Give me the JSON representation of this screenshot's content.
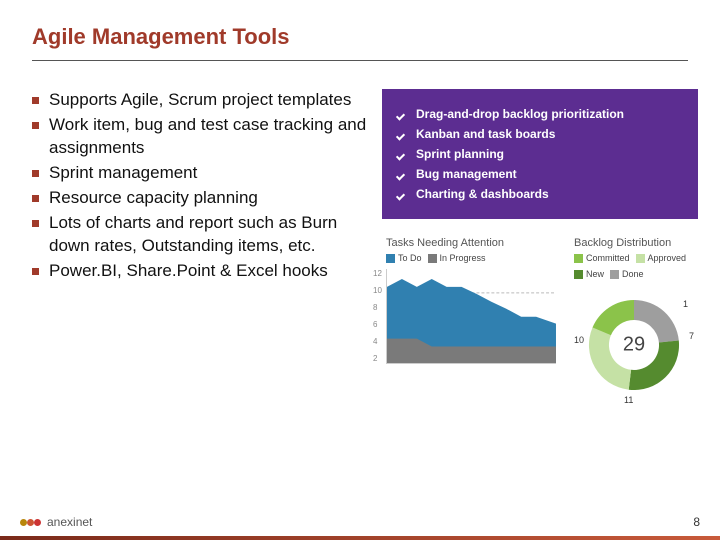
{
  "title": "Agile Management Tools",
  "bullets": [
    "Supports Agile, Scrum project templates",
    "Work item, bug and test case tracking and assignments",
    "Sprint management",
    "Resource capacity planning",
    "Lots of charts and report such as Burn down rates, Outstanding items, etc.",
    "Power.BI, Share.Point & Excel hooks"
  ],
  "purple_features": [
    "Drag-and-drop backlog prioritization",
    "Kanban and task boards",
    "Sprint planning",
    "Bug management",
    "Charting & dashboards"
  ],
  "chart_data": [
    {
      "type": "area",
      "title": "Tasks Needing Attention",
      "series": [
        {
          "name": "To Do",
          "color": "#3080b0",
          "values": [
            9,
            10,
            9,
            10,
            9,
            9,
            8,
            7,
            6,
            5,
            5,
            4
          ]
        },
        {
          "name": "In Progress",
          "color": "#7a7a7a",
          "values": [
            3,
            3,
            3,
            2,
            2,
            2,
            2,
            2,
            2,
            2,
            2,
            2
          ]
        }
      ],
      "y_ticks": [
        "12",
        "10",
        "8",
        "6",
        "4",
        "2"
      ],
      "ylim": [
        0,
        13
      ]
    },
    {
      "type": "pie",
      "title": "Backlog Distribution",
      "total_label": "29",
      "series": [
        {
          "name": "Committed",
          "color": "#8bc34a",
          "value": 10
        },
        {
          "name": "Approved",
          "color": "#c5e1a5",
          "value": 11
        },
        {
          "name": "New",
          "color": "#558b2f",
          "value": 7
        },
        {
          "name": "Done",
          "color": "#9e9e9e",
          "value": 1
        }
      ]
    }
  ],
  "footer": {
    "logo_text": "anexinet",
    "page": "8"
  }
}
